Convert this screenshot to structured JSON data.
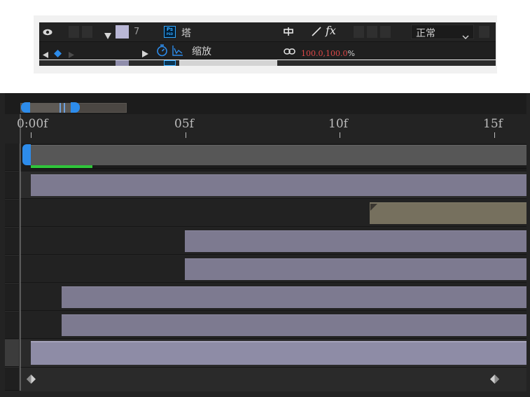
{
  "layer": {
    "index": "7",
    "name": "塔",
    "property": "缩放",
    "scale_x": "100.0",
    "scale_sep": ",",
    "scale_y": "100.0",
    "scale_unit": "%",
    "blend_mode": "正常",
    "label_color": "#b9b7d6",
    "fx_label": "fx",
    "ps_badge_top": "Ps",
    "ps_badge_bottom": "PSD"
  },
  "timeline": {
    "ruler_labels": [
      "0:00f",
      "05f",
      "10f",
      "15f"
    ],
    "colors": {
      "layer_bar": "#7d7a90",
      "adjust_bar": "#76705e",
      "work_area": "#575757",
      "progress": "#2fc53a",
      "playhead": "#2d8ceb"
    }
  }
}
